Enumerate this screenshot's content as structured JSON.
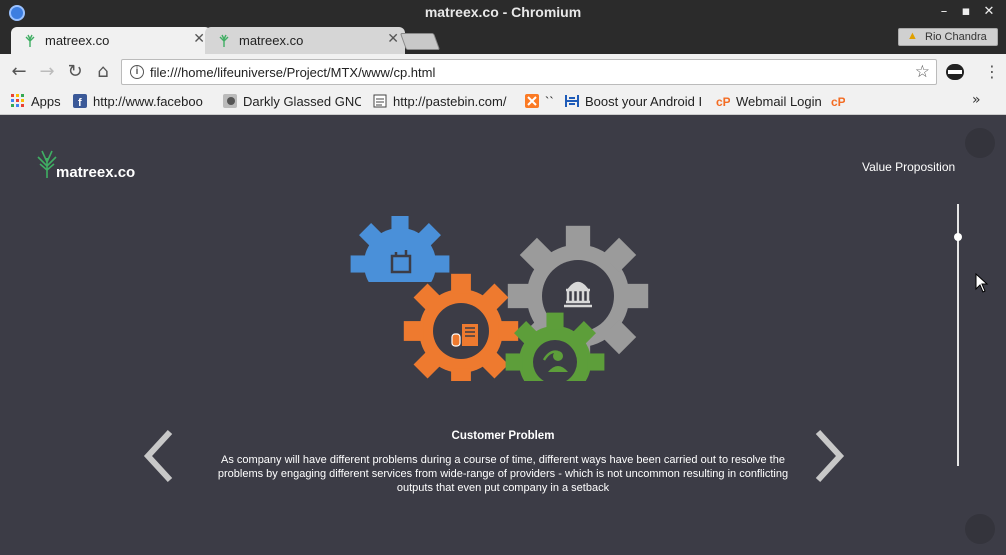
{
  "window": {
    "title": "matreex.co - Chromium"
  },
  "tabs": [
    {
      "label": "matreex.co",
      "active": true
    },
    {
      "label": "matreex.co",
      "active": false
    }
  ],
  "profile": {
    "name": "Rio Chandra"
  },
  "address_bar": {
    "url": "file:///home/lifeuniverse/Project/MTX/www/cp.html"
  },
  "bookmarks": [
    {
      "label": "Apps",
      "icon": "apps-grid-icon"
    },
    {
      "label": "http://www.faceboo",
      "icon": "facebook-icon"
    },
    {
      "label": "Darkly Glassed GNO",
      "icon": "gnome-icon"
    },
    {
      "label": "http://pastebin.com/",
      "icon": "pastebin-icon"
    },
    {
      "label": "``",
      "icon": "xampp-icon"
    },
    {
      "label": "Boost your Android I",
      "icon": "android-icon"
    },
    {
      "label": "Webmail Login",
      "icon": "cpanel-icon"
    },
    {
      "label": "",
      "icon": "cpanel-icon"
    }
  ],
  "page": {
    "brand": "matreex.co",
    "nav_label": "Value Proposition",
    "slide": {
      "title": "Customer Problem",
      "body": "As company will have different problems during a course of time, different ways have been carried out to resolve the problems by engaging different services from wide-range of providers - which is not uncommon resulting in conflicting outputs that even put company in a setback"
    },
    "colors": {
      "background": "#3c3c46",
      "gear_blue": "#4a90d9",
      "gear_orange": "#ee7a2f",
      "gear_gray": "#9b9b9b",
      "gear_green": "#5d9e3a"
    }
  }
}
